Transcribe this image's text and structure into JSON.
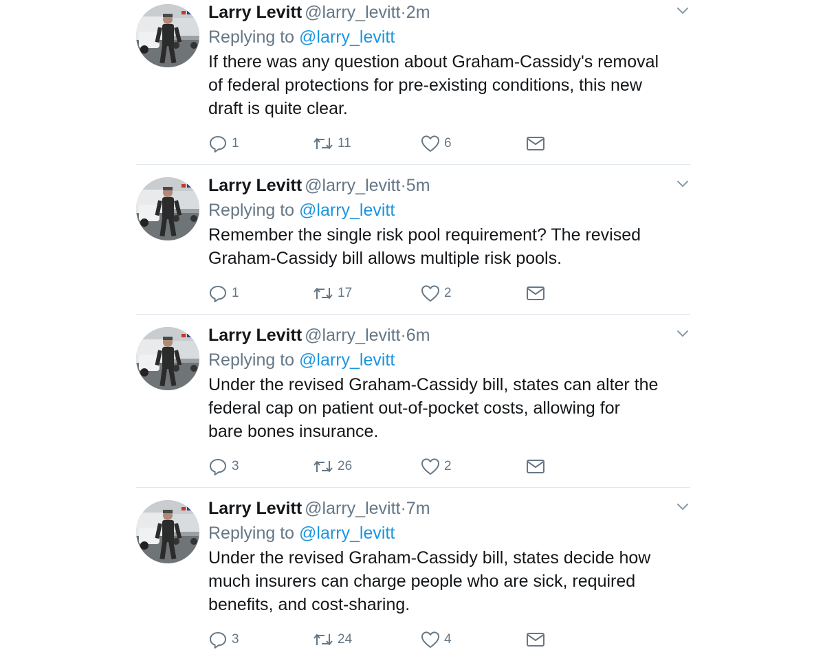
{
  "colors": {
    "text": "#14171a",
    "secondary": "#657786",
    "link": "#1b95e0",
    "divider": "#e1e8ed"
  },
  "icons": {
    "reply": "reply-icon",
    "retweet": "retweet-icon",
    "like": "heart-icon",
    "dm": "envelope-icon",
    "menu": "chevron-down-icon",
    "avatar": "profile-photo"
  },
  "tweets": [
    {
      "name": "Larry Levitt",
      "handle": "@larry_levitt",
      "separator": "·",
      "time": "2m",
      "replying_prefix": "Replying to",
      "replying_to": "@larry_levitt",
      "lines": [
        "If there was any question about Graham-Cassidy's removal",
        "of federal protections for pre-existing conditions, this new",
        "draft is quite clear."
      ],
      "replies": "1",
      "retweets": "11",
      "likes": "6"
    },
    {
      "name": "Larry Levitt",
      "handle": "@larry_levitt",
      "separator": "·",
      "time": "5m",
      "replying_prefix": "Replying to",
      "replying_to": "@larry_levitt",
      "lines": [
        "Remember the single risk pool requirement? The revised",
        "Graham-Cassidy bill allows multiple risk pools."
      ],
      "replies": "1",
      "retweets": "17",
      "likes": "2"
    },
    {
      "name": "Larry Levitt",
      "handle": "@larry_levitt",
      "separator": "·",
      "time": "6m",
      "replying_prefix": "Replying to",
      "replying_to": "@larry_levitt",
      "lines": [
        "Under the revised Graham-Cassidy bill, states can alter the",
        "federal cap on patient out-of-pocket costs, allowing for",
        "bare bones insurance."
      ],
      "replies": "3",
      "retweets": "26",
      "likes": "2"
    },
    {
      "name": "Larry Levitt",
      "handle": "@larry_levitt",
      "separator": "·",
      "time": "7m",
      "replying_prefix": "Replying to",
      "replying_to": "@larry_levitt",
      "lines": [
        "Under the revised Graham-Cassidy bill, states decide how",
        "much insurers can charge people who are sick, required",
        "benefits, and cost-sharing."
      ],
      "replies": "3",
      "retweets": "24",
      "likes": "4"
    }
  ]
}
